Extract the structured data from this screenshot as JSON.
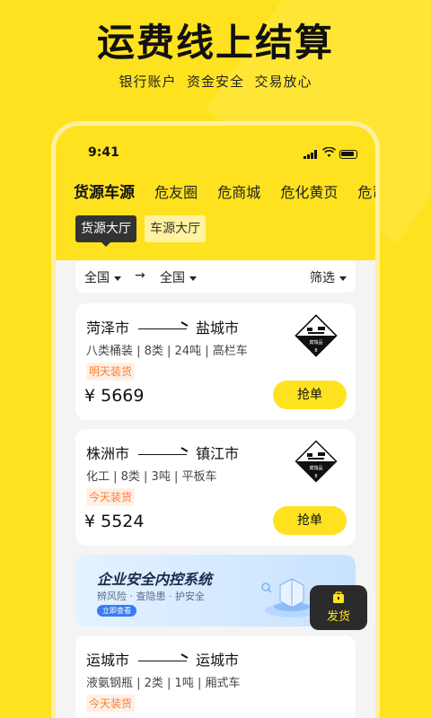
{
  "promo": {
    "title": "运费线上结算",
    "subtitle": "银行账户  资金安全  交易放心"
  },
  "status_bar": {
    "time": "9:41"
  },
  "tabs": [
    {
      "label": "货源车源",
      "active": true
    },
    {
      "label": "危友圈",
      "active": false
    },
    {
      "label": "危商城",
      "active": false
    },
    {
      "label": "危化黄页",
      "active": false
    },
    {
      "label": "危司",
      "active": false
    }
  ],
  "subtabs": [
    {
      "label": "货源大厅",
      "active": true
    },
    {
      "label": "车源大厅",
      "active": false
    }
  ],
  "filter": {
    "origin": "全国",
    "destination": "全国",
    "arrow": "→",
    "screen": "筛选"
  },
  "cards": [
    {
      "from": "菏泽市",
      "to": "盐城市",
      "specs": "八类桶装 | 8类 | 24吨 | 高栏车",
      "tag": "明天装货",
      "price": "¥ 5669",
      "button": "抢单",
      "hazard_label": "腐蚀品",
      "hazard_class": "8"
    },
    {
      "from": "株洲市",
      "to": "镇江市",
      "specs": "化工 | 8类 | 3吨 | 平板车",
      "tag": "今天装货",
      "price": "¥ 5524",
      "button": "抢单",
      "hazard_label": "腐蚀品",
      "hazard_class": "8"
    },
    {
      "from": "运城市",
      "to": "运城市",
      "specs": "液氨钢瓶 | 2类 | 1吨 | 厢式车",
      "tag": "今天装货",
      "price": "",
      "button": "",
      "hazard_label": "",
      "hazard_class": ""
    }
  ],
  "banner": {
    "title": "企业安全内控系统",
    "subtitle": "辨风险 · 查隐患 · 护安全",
    "button": "立即查看"
  },
  "fab": {
    "label": "发货"
  },
  "colors": {
    "brand_yellow": "#FFE21F",
    "tag_orange": "#FF7A2E",
    "dark": "#2B2B2B"
  }
}
